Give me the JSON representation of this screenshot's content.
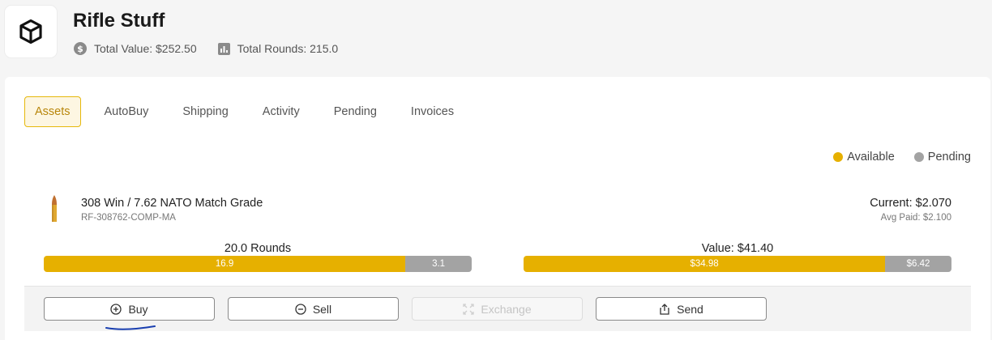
{
  "header": {
    "title": "Rifle Stuff",
    "total_value": "Total Value: $252.50",
    "total_rounds": "Total Rounds: 215.0",
    "logo_icon": "cube-icon"
  },
  "tabs": [
    {
      "label": "Assets",
      "active": true
    },
    {
      "label": "AutoBuy",
      "active": false
    },
    {
      "label": "Shipping",
      "active": false
    },
    {
      "label": "Activity",
      "active": false
    },
    {
      "label": "Pending",
      "active": false
    },
    {
      "label": "Invoices",
      "active": false
    }
  ],
  "legend": {
    "available": "Available",
    "pending": "Pending"
  },
  "colors": {
    "available": "#e6b000",
    "pending": "#a3a3a3",
    "accent": "#e6b80c"
  },
  "item": {
    "name": "308 Win / 7.62 NATO Match Grade",
    "sku": "RF-308762-COMP-MA",
    "current": "Current: $2.070",
    "avg_paid": "Avg Paid: $2.100",
    "rounds_label": "20.0 Rounds",
    "rounds_available": 16.9,
    "rounds_pending": 3.1,
    "rounds_available_text": "16.9",
    "rounds_pending_text": "3.1",
    "value_label": "Value: $41.40",
    "value_available": 34.98,
    "value_pending": 6.42,
    "value_available_text": "$34.98",
    "value_pending_text": "$6.42"
  },
  "actions": {
    "buy": "Buy",
    "sell": "Sell",
    "exchange": "Exchange",
    "send": "Send"
  }
}
